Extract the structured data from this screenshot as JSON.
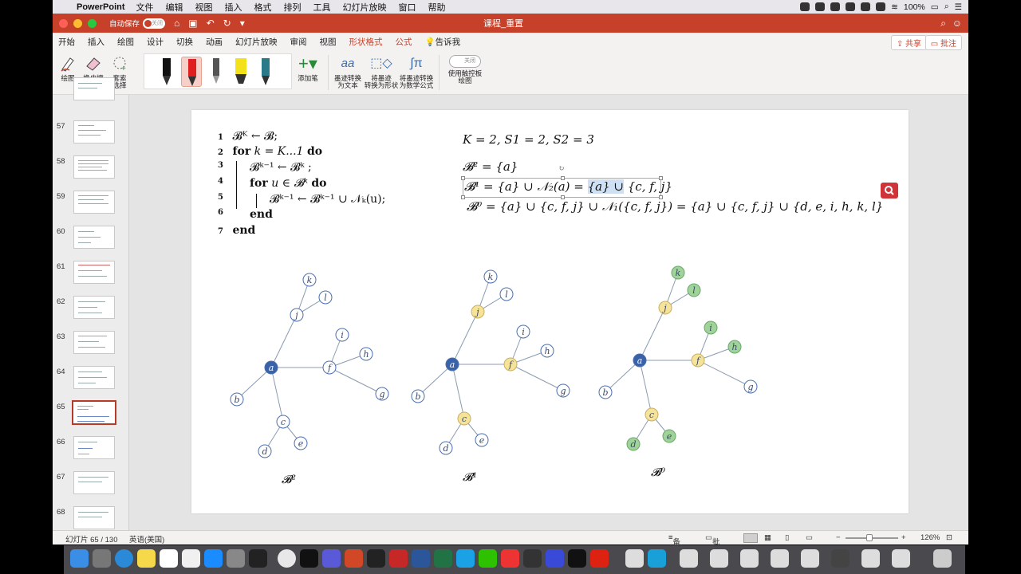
{
  "menubar": {
    "app": "PowerPoint",
    "items": [
      "文件",
      "编辑",
      "视图",
      "插入",
      "格式",
      "排列",
      "工具",
      "幻灯片放映",
      "窗口",
      "帮助"
    ],
    "battery": "100%",
    "time": "10:47"
  },
  "titlebar": {
    "autosave_label": "自动保存",
    "autosave_state": "关闭",
    "doc_title": "课程_重置"
  },
  "tabs": [
    "开始",
    "插入",
    "绘图",
    "设计",
    "切换",
    "动画",
    "幻灯片放映",
    "审阅",
    "视图",
    "形状格式",
    "公式",
    "告诉我"
  ],
  "active_tab": "绘图",
  "share_label": "共享",
  "comment_label": "批注",
  "ribbon": {
    "draw": "绘图",
    "eraser": "橡皮擦",
    "lasso1": "套索",
    "lasso2": "选择",
    "add_pen": "添加笔",
    "ink_text1": "墨迹转换",
    "ink_text2": "为文本",
    "ink_shape1": "将墨迹",
    "ink_shape2": "转换为形状",
    "ink_math1": "将墨迹转换",
    "ink_math2": "为数学公式",
    "touch_state": "关闭",
    "touch1": "使用触控板",
    "touch2": "绘图"
  },
  "thumbnails": {
    "numbers": [
      "57",
      "58",
      "59",
      "60",
      "61",
      "62",
      "63",
      "64",
      "65",
      "66",
      "67",
      "68"
    ],
    "selected": "65"
  },
  "slide": {
    "algo": {
      "l1_num": "1",
      "l1": "𝓑ᴷ ← 𝓑;",
      "l2_num": "2",
      "l2_kw": "for",
      "l2_mid": " k = K...1 ",
      "l2_kw2": "do",
      "l3_num": "3",
      "l3": "𝓑ᵏ⁻¹ ← 𝓑ᵏ ;",
      "l4_num": "4",
      "l4_kw": "for",
      "l4_mid": " u ∈ 𝓑ᵏ ",
      "l4_kw2": "do",
      "l5_num": "5",
      "l5": "𝓑ᵏ⁻¹ ← 𝓑ᵏ⁻¹ ∪ 𝒩ₖ(u);",
      "l6_num": "6",
      "l6": "end",
      "l7_num": "7",
      "l7": "end"
    },
    "formulas": {
      "params": "K = 2, S1 = 2, S2 = 3",
      "b2": "𝓑² = {a}",
      "b1_a": "𝓑¹ = {a} ∪ 𝒩₂(a) = ",
      "b1_b": "{a} ∪",
      "b1_c": " {c, f, j}",
      "b0": "𝓑⁰ = {a} ∪ {c, f, j} ∪ 𝒩₁({c, f, j}) = {a} ∪ {c, f, j} ∪ {d, e, i, h, k, l}"
    },
    "graph_labels": [
      "𝓑²",
      "𝓑¹",
      "𝓑⁰"
    ],
    "node_colors": {
      "blue": "#3a62a8",
      "yellow": "#f6e39a",
      "green": "#9fd39a",
      "white": "#ffffff",
      "stroke": "#4b6fae",
      "edge": "#8a9bb0"
    }
  },
  "status": {
    "slide_info": "幻灯片 65 / 130",
    "language": "英语(美国)",
    "notes": "备注",
    "comments": "批注",
    "zoom": "126%"
  }
}
